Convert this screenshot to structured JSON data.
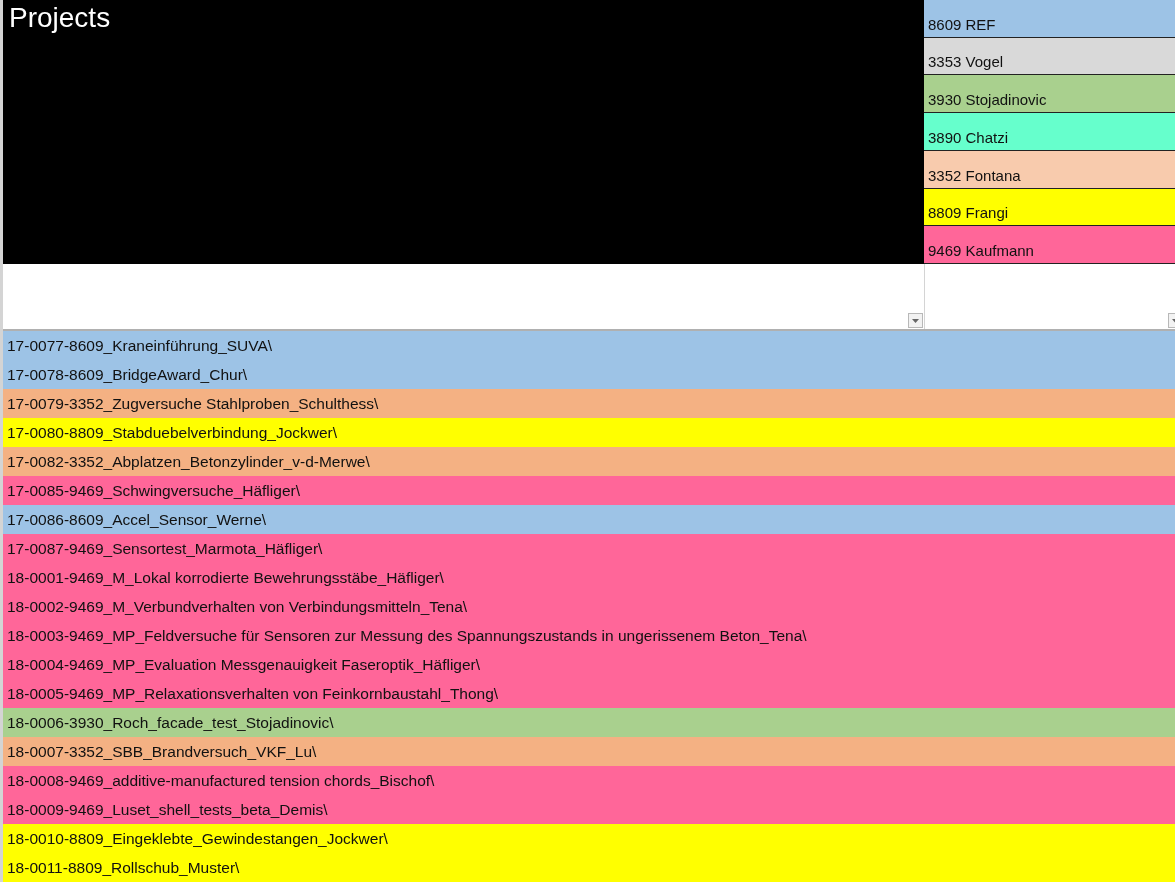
{
  "title": "Projects",
  "legend": [
    {
      "label": "8609 REF",
      "color": "#9dc3e6"
    },
    {
      "label": "3353 Vogel",
      "color": "#d9d9d9"
    },
    {
      "label": "3930 Stojadinovic",
      "color": "#a9d08e"
    },
    {
      "label": "3890 Chatzi",
      "color": "#66ffcc"
    },
    {
      "label": "3352 Fontana",
      "color": "#f8cbad"
    },
    {
      "label": "8809 Frangi",
      "color": "#ffff00"
    },
    {
      "label": "9469 Kaufmann",
      "color": "#ff6699"
    }
  ],
  "rows": [
    {
      "label": "17-0077-8609_Kraneinführung_SUVA\\",
      "color": "#9dc3e6"
    },
    {
      "label": "17-0078-8609_BridgeAward_Chur\\",
      "color": "#9dc3e6"
    },
    {
      "label": "17-0079-3352_Zugversuche Stahlproben_Schulthess\\",
      "color": "#f4b183"
    },
    {
      "label": "17-0080-8809_Stabduebelverbindung_Jockwer\\",
      "color": "#ffff00"
    },
    {
      "label": "17-0082-3352_Abplatzen_Betonzylinder_v-d-Merwe\\",
      "color": "#f4b183"
    },
    {
      "label": "17-0085-9469_Schwingversuche_Häfliger\\",
      "color": "#ff6699"
    },
    {
      "label": "17-0086-8609_Accel_Sensor_Werne\\",
      "color": "#9dc3e6"
    },
    {
      "label": "17-0087-9469_Sensortest_Marmota_Häfliger\\",
      "color": "#ff6699"
    },
    {
      "label": "18-0001-9469_M_Lokal korrodierte Bewehrungsstäbe_Häfliger\\",
      "color": "#ff6699"
    },
    {
      "label": "18-0002-9469_M_Verbundverhalten von Verbindungsmitteln_Tena\\",
      "color": "#ff6699"
    },
    {
      "label": "18-0003-9469_MP_Feldversuche für Sensoren zur Messung des Spannungszustands in ungerissenem Beton_Tena\\",
      "color": "#ff6699"
    },
    {
      "label": "18-0004-9469_MP_Evaluation Messgenauigkeit Faseroptik_Häfliger\\",
      "color": "#ff6699"
    },
    {
      "label": "18-0005-9469_MP_Relaxationsverhalten von Feinkornbaustahl_Thong\\",
      "color": "#ff6699"
    },
    {
      "label": "18-0006-3930_Roch_facade_test_Stojadinovic\\",
      "color": "#a9d08e"
    },
    {
      "label": "18-0007-3352_SBB_Brandversuch_VKF_Lu\\",
      "color": "#f4b183"
    },
    {
      "label": "18-0008-9469_additive-manufactured tension chords_Bischof\\",
      "color": "#ff6699"
    },
    {
      "label": "18-0009-9469_Luset_shell_tests_beta_Demis\\",
      "color": "#ff6699"
    },
    {
      "label": "18-0010-8809_Eingeklebte_Gewindestangen_Jockwer\\",
      "color": "#ffff00"
    },
    {
      "label": "18-0011-8809_Rollschub_Muster\\",
      "color": "#ffff00"
    }
  ]
}
